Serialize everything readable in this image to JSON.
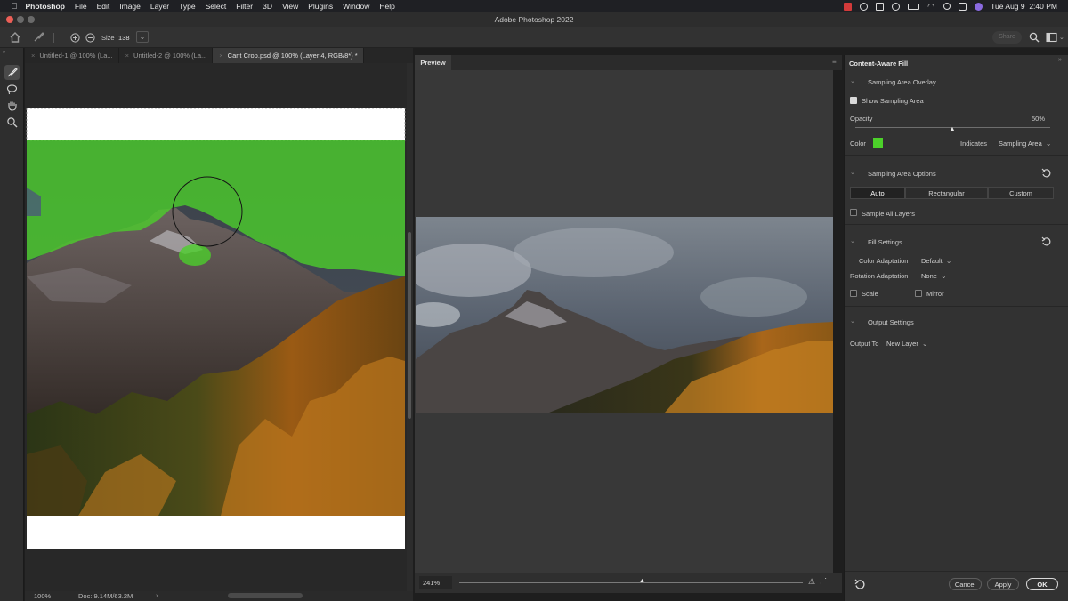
{
  "menubar": {
    "app": "Photoshop",
    "items": [
      "File",
      "Edit",
      "Image",
      "Layer",
      "Type",
      "Select",
      "Filter",
      "3D",
      "View",
      "Plugins",
      "Window",
      "Help"
    ],
    "clock": "Tue Aug 9  2:40 PM"
  },
  "window": {
    "title": "Adobe Photoshop 2022"
  },
  "options": {
    "size_label": "Size",
    "size_value": "138",
    "share_label": "Share"
  },
  "tabs": [
    {
      "label": "Untitled-1 @ 100% (La..."
    },
    {
      "label": "Untitled-2 @ 100% (La..."
    },
    {
      "label": "Cant Crop.psd @ 100% (Layer 4, RGB/8*) *"
    }
  ],
  "status": {
    "zoom": "100%",
    "doc": "Doc: 9.14M/63.2M"
  },
  "preview": {
    "tab_label": "Preview",
    "zoom": "241%"
  },
  "caf": {
    "title": "Content-Aware Fill",
    "overlay": {
      "heading": "Sampling Area Overlay",
      "show_label": "Show Sampling Area",
      "show_checked": true,
      "opacity_label": "Opacity",
      "opacity_value": "50%",
      "opacity": 0.5,
      "color_label": "Color",
      "color": "#4cd12a",
      "indicates_label": "Indicates",
      "indicates_value": "Sampling Area"
    },
    "options": {
      "heading": "Sampling Area Options",
      "modes": [
        "Auto",
        "Rectangular",
        "Custom"
      ],
      "active_mode": "Auto",
      "sample_all_label": "Sample All Layers",
      "sample_all_checked": false
    },
    "fill": {
      "heading": "Fill Settings",
      "color_adapt_label": "Color Adaptation",
      "color_adapt_value": "Default",
      "rotation_label": "Rotation Adaptation",
      "rotation_value": "None",
      "scale_label": "Scale",
      "mirror_label": "Mirror"
    },
    "output": {
      "heading": "Output Settings",
      "output_to_label": "Output To",
      "output_to_value": "New Layer"
    },
    "buttons": {
      "cancel": "Cancel",
      "apply": "Apply",
      "ok": "OK"
    }
  }
}
